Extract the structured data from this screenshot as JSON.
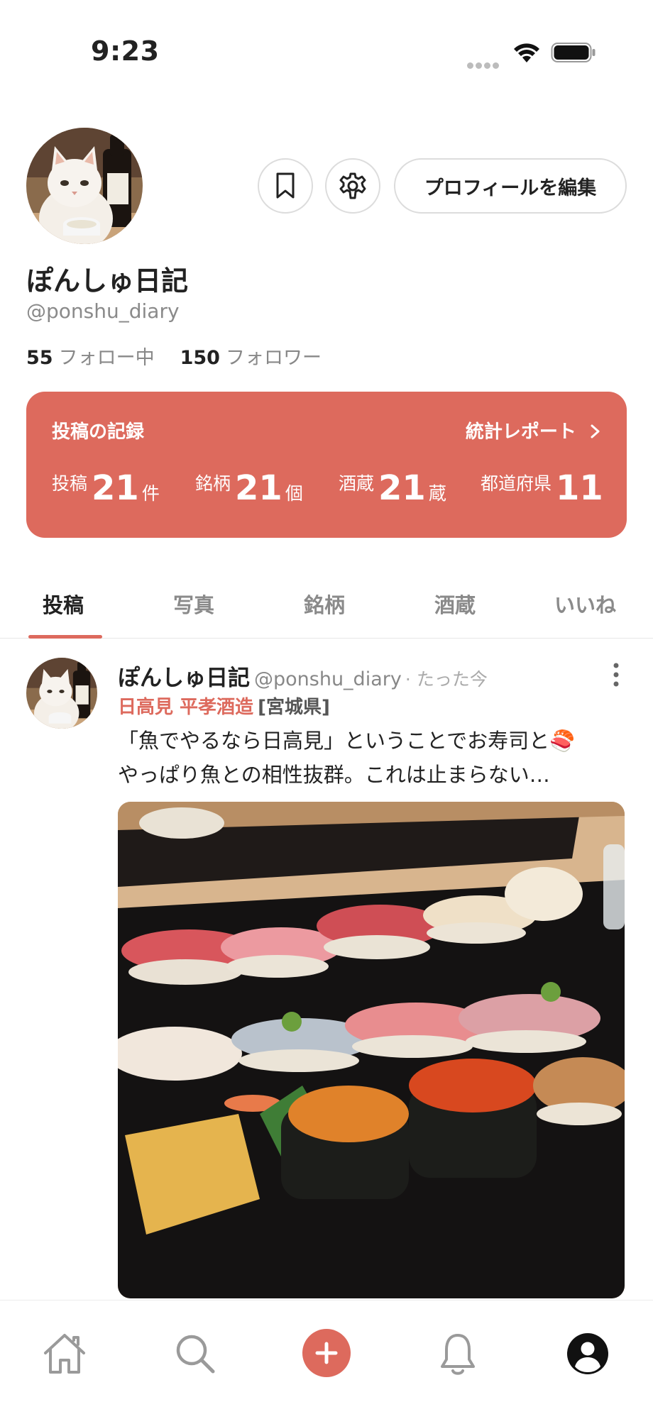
{
  "status_bar": {
    "time": "9:23"
  },
  "profile": {
    "display_name": "ぽんしゅ日記",
    "handle": "@ponshu_diary",
    "following_count": "55",
    "following_label": "フォロー中",
    "followers_count": "150",
    "followers_label": "フォロワー",
    "edit_button_label": "プロフィールを編集"
  },
  "stats": {
    "title": "投稿の記録",
    "report_link": "統計レポート",
    "items": [
      {
        "label": "投稿",
        "value": "21",
        "unit": "件"
      },
      {
        "label": "銘柄",
        "value": "21",
        "unit": "個"
      },
      {
        "label": "酒蔵",
        "value": "21",
        "unit": "蔵"
      },
      {
        "label": "都道府県",
        "value": "11",
        "unit": ""
      }
    ],
    "color": "#dd6a5d"
  },
  "tabs": [
    {
      "label": "投稿",
      "active": true
    },
    {
      "label": "写真",
      "active": false
    },
    {
      "label": "銘柄",
      "active": false
    },
    {
      "label": "酒蔵",
      "active": false
    },
    {
      "label": "いいね",
      "active": false
    }
  ],
  "post": {
    "author_name": "ぽんしゅ日記",
    "author_handle": "@ponshu_diary",
    "time": "· たった今",
    "sake_name": "日高見 平孝酒造",
    "prefecture": "[宮城県]",
    "text_line1": "「魚でやるなら日高見」ということでお寿司と🍣",
    "text_line2": "やっぱり魚との相性抜群。これは止まらない…"
  },
  "bottom_nav": {
    "items": [
      "home-icon",
      "search-icon",
      "add-post-icon",
      "bell-icon",
      "account-icon"
    ]
  },
  "colors": {
    "accent": "#dd6a5d"
  }
}
